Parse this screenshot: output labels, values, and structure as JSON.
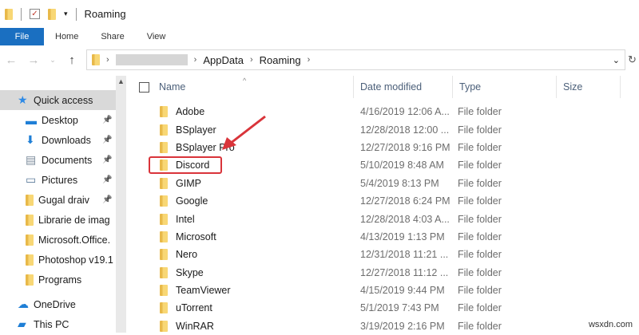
{
  "window": {
    "title": "Roaming"
  },
  "ribbon": {
    "tabs": [
      "File",
      "Home",
      "Share",
      "View"
    ]
  },
  "address": {
    "segments": [
      "AppData",
      "Roaming"
    ]
  },
  "sidebar": {
    "items": [
      {
        "label": "Quick access",
        "icon": "star-icon",
        "pinned": false,
        "selected": true
      },
      {
        "label": "Desktop",
        "icon": "desktop-icon",
        "pinned": true
      },
      {
        "label": "Downloads",
        "icon": "download-icon",
        "pinned": true
      },
      {
        "label": "Documents",
        "icon": "document-icon",
        "pinned": true
      },
      {
        "label": "Pictures",
        "icon": "picture-icon",
        "pinned": true
      },
      {
        "label": "Gugal draiv",
        "icon": "folder-icon",
        "pinned": true
      },
      {
        "label": "Librarie de imag",
        "icon": "folder-icon",
        "pinned": false
      },
      {
        "label": "Microsoft.Office.",
        "icon": "folder-icon",
        "pinned": false
      },
      {
        "label": "Photoshop v19.1",
        "icon": "folder-icon",
        "pinned": false
      },
      {
        "label": "Programs",
        "icon": "folder-icon",
        "pinned": false
      },
      {
        "label": "OneDrive",
        "icon": "cloud-icon",
        "pinned": false
      },
      {
        "label": "This PC",
        "icon": "computer-icon",
        "pinned": false
      }
    ]
  },
  "columns": [
    "Name",
    "Date modified",
    "Type",
    "Size"
  ],
  "rows": [
    {
      "name": "Adobe",
      "date": "4/16/2019 12:06 A...",
      "type": "File folder"
    },
    {
      "name": "BSplayer",
      "date": "12/28/2018 12:00 ...",
      "type": "File folder"
    },
    {
      "name": "BSplayer Pro",
      "date": "12/27/2018 9:16 PM",
      "type": "File folder"
    },
    {
      "name": "Discord",
      "date": "5/10/2019 8:48 AM",
      "type": "File folder",
      "highlighted": true
    },
    {
      "name": "GIMP",
      "date": "5/4/2019 8:13 PM",
      "type": "File folder"
    },
    {
      "name": "Google",
      "date": "12/27/2018 6:24 PM",
      "type": "File folder"
    },
    {
      "name": "Intel",
      "date": "12/28/2018 4:03 A...",
      "type": "File folder"
    },
    {
      "name": "Microsoft",
      "date": "4/13/2019 1:13 PM",
      "type": "File folder"
    },
    {
      "name": "Nero",
      "date": "12/31/2018 11:21 ...",
      "type": "File folder"
    },
    {
      "name": "Skype",
      "date": "12/27/2018 11:12 ...",
      "type": "File folder"
    },
    {
      "name": "TeamViewer",
      "date": "4/15/2019 9:44 PM",
      "type": "File folder"
    },
    {
      "name": "uTorrent",
      "date": "5/1/2019 7:43 PM",
      "type": "File folder"
    },
    {
      "name": "WinRAR",
      "date": "3/19/2019 2:16 PM",
      "type": "File folder"
    }
  ],
  "colors": {
    "accent": "#1a6fc1",
    "highlight": "#d9343a"
  },
  "watermark": "wsxdn.com"
}
